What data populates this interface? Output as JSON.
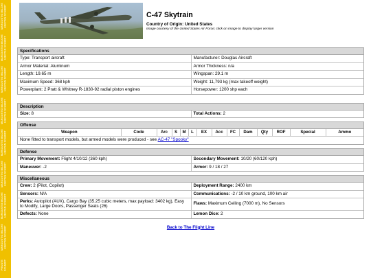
{
  "sidebar": {
    "stamps": [
      "MARIZUSTIG MILCHE HIERTEN SCHMIDT",
      "MARIZUSTIG MILCHE HIERTEN SCHMIDT",
      "MARIZUSTIG MILCHE HIERTEN SCHMIDT",
      "MARIZUSTIG MILCHE HIERTEN SCHMIDT",
      "MARIZUSTIG MILCHE HIERTEN SCHMIDT",
      "MARIZUSTIG MILCHE HIERTEN SCHMIDT",
      "MARIZUSTIG MILCHE HIERTEN SCHMIDT",
      "MARIZUSTIG MILCHE HIERTEN SCHMIDT",
      "PRIVATE SCHMIDT"
    ]
  },
  "header": {
    "title": "C-47 Skytrain",
    "origin_label": "Country of Origin:",
    "origin_value": "United States",
    "courtesy": "Image courtesy of the United States Air Force; click on image to display larger version"
  },
  "specs": {
    "heading": "Specifications",
    "rows": [
      [
        "Type: Transport aircraft",
        "Manufacturer: Douglas Aircraft"
      ],
      [
        "Armor Material: Aluminum",
        "Armor Thickness: n/a"
      ],
      [
        "Length: 19.65 m",
        "Wingspan: 29.1 m"
      ],
      [
        "Maximum Speed: 368 kph",
        "Weight: 11,793 kg (max takeoff weight)"
      ],
      [
        "Powerplant: 2 Pratt & Whitney R-1830-92 radial piston engines",
        "Horsepower: 1200 shp each"
      ]
    ]
  },
  "description": {
    "heading": "Description",
    "size_label": "Size:",
    "size_value": "8",
    "actions_label": "Total Actions:",
    "actions_value": "2"
  },
  "offense": {
    "heading": "Offense",
    "columns": [
      "Weapon",
      "Code",
      "Arc",
      "S",
      "M",
      "L",
      "EX",
      "Acc",
      "FC",
      "Dam",
      "Qty",
      "ROF",
      "Special",
      "Ammo"
    ],
    "note": "None fitted to transport models, but armed models were produced - see",
    "note_link": "AC-47 \"Spooky\""
  },
  "defense": {
    "heading": "Defense",
    "primary_label": "Primary Movement:",
    "primary_value": "Flight 4/10/12 (360 kph)",
    "secondary_label": "Secondary Movement:",
    "secondary_value": "10/20 (60/120 kph)",
    "maneuver_label": "Maneuver:",
    "maneuver_value": "-2",
    "armor_label": "Armor:",
    "armor_value": "9 / 18 / 27"
  },
  "misc": {
    "heading": "Miscellaneous",
    "crew_label": "Crew:",
    "crew_value": "2 (Pilot, Copilot)",
    "deploy_label": "Deployment Range:",
    "deploy_value": "2400 km",
    "sensors_label": "Sensors:",
    "sensors_value": "N/A",
    "comms_label": "Communications:",
    "comms_value": "-2 / 10 km ground, 100 km air",
    "perks_label": "Perks:",
    "perks_value": "Autopilot (AUX), Cargo Bay (35.25 cubic meters, max payload: 3402 kg), Easy to Modify, Large Doors, Passenger Seats (26)",
    "flaws_label": "Flaws:",
    "flaws_value": "Maximum Ceiling (7000 m), No Sensors",
    "defects_label": "Defects:",
    "defects_value": "None",
    "lemon_label": "Lemon Dice:",
    "lemon_value": "2"
  },
  "footer": {
    "back_link": "Back to The Flight Line"
  }
}
